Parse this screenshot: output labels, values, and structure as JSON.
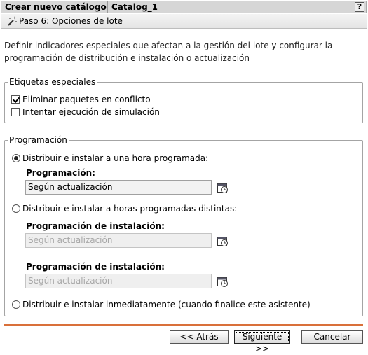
{
  "header": {
    "title": "Crear nuevo catálogo",
    "catalog_name": "Catalog_1",
    "help_label": "?"
  },
  "step": {
    "title": "Paso 6: Opciones de lote",
    "icon": "wand-icon"
  },
  "description": "Definir indicadores especiales que afectan a la gestión del lote y configurar la programación de distribución e instalación o actualización",
  "special_tags": {
    "legend": "Etiquetas especiales",
    "options": [
      {
        "label": "Eliminar paquetes en conflicto",
        "checked": true
      },
      {
        "label": "Intentar ejecución de simulación",
        "checked": false
      }
    ]
  },
  "schedule": {
    "legend": "Programación",
    "option1": {
      "label": "Distribuir e instalar a una hora programada:",
      "selected": true,
      "field_label": "Programación:",
      "value": "Según actualización"
    },
    "option2": {
      "label": "Distribuir e instalar a horas programadas distintas:",
      "selected": false,
      "field1_label": "Programación de instalación:",
      "field1_value": "Según actualización",
      "field2_label": "Programación de instalación:",
      "field2_value": "Según actualización"
    },
    "option3": {
      "label": "Distribuir e instalar inmediatamente (cuando finalice este asistente)",
      "selected": false
    },
    "calendar_icon": "calendar-clock-icon"
  },
  "footer": {
    "back_label": "<< Atrás",
    "next_label": "Siguiente >>",
    "cancel_label": "Cancelar",
    "accent_color": "#d9703a"
  }
}
